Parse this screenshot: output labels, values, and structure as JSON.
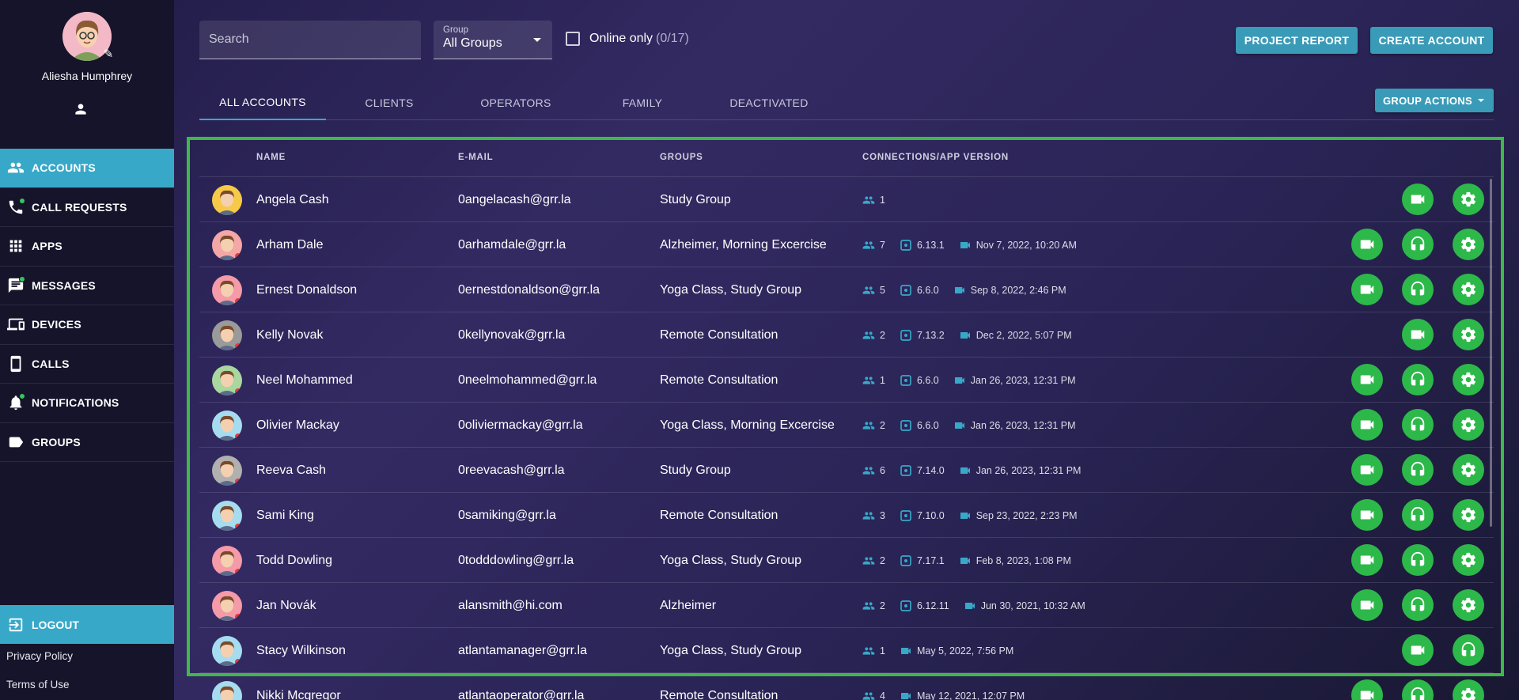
{
  "profile": {
    "name": "Aliesha Humphrey"
  },
  "nav": [
    {
      "label": "ACCOUNTS",
      "icon": "people-icon",
      "active": true,
      "dot": false
    },
    {
      "label": "CALL REQUESTS",
      "icon": "phone-icon",
      "active": false,
      "dot": true
    },
    {
      "label": "APPS",
      "icon": "apps-grid-icon",
      "active": false,
      "dot": false
    },
    {
      "label": "MESSAGES",
      "icon": "message-icon",
      "active": false,
      "dot": true
    },
    {
      "label": "DEVICES",
      "icon": "devices-icon",
      "active": false,
      "dot": false
    },
    {
      "label": "CALLS",
      "icon": "smartphone-icon",
      "active": false,
      "dot": false
    },
    {
      "label": "NOTIFICATIONS",
      "icon": "bell-icon",
      "active": false,
      "dot": true
    },
    {
      "label": "GROUPS",
      "icon": "label-icon",
      "active": false,
      "dot": false
    }
  ],
  "logout": "LOGOUT",
  "footer": {
    "privacy": "Privacy Policy",
    "terms": "Terms of Use"
  },
  "search": {
    "placeholder": "Search"
  },
  "group_filter": {
    "label": "Group",
    "value": "All Groups"
  },
  "online": {
    "label": "Online only",
    "count": "(0/17)"
  },
  "buttons": {
    "project_report": "PROJECT REPORT",
    "create_account": "CREATE ACCOUNT",
    "group_actions": "GROUP ACTIONS"
  },
  "tabs": [
    "ALL ACCOUNTS",
    "CLIENTS",
    "OPERATORS",
    "FAMILY",
    "DEACTIVATED"
  ],
  "columns": {
    "name": "NAME",
    "email": "E-MAIL",
    "groups": "GROUPS",
    "connections": "CONNECTIONS/APP VERSION"
  },
  "accounts": [
    {
      "name": "Angela Cash",
      "email": "0angelacash@grr.la",
      "groups": "Study Group",
      "connections": "1",
      "version": "",
      "last_call": "",
      "video": true,
      "audio": false,
      "settings": true,
      "avatar_color": "#f7c948",
      "status": "none"
    },
    {
      "name": "Arham Dale",
      "email": "0arhamdale@grr.la",
      "groups": "Alzheimer, Morning Excercise",
      "connections": "7",
      "version": "6.13.1",
      "last_call": "Nov 7, 2022, 10:20 AM",
      "video": true,
      "audio": true,
      "settings": true,
      "avatar_color": "#f4a7a7",
      "status": "offline"
    },
    {
      "name": "Ernest Donaldson",
      "email": "0ernestdonaldson@grr.la",
      "groups": "Yoga Class, Study Group",
      "connections": "5",
      "version": "6.6.0",
      "last_call": "Sep 8, 2022, 2:46 PM",
      "video": true,
      "audio": true,
      "settings": true,
      "avatar_color": "#f49aa8",
      "status": "offline"
    },
    {
      "name": "Kelly Novak",
      "email": "0kellynovak@grr.la",
      "groups": "Remote Consultation",
      "connections": "2",
      "version": "7.13.2",
      "last_call": "Dec 2, 2022, 5:07 PM",
      "video": true,
      "audio": false,
      "settings": true,
      "avatar_color": "#9a9a9a",
      "status": "offline"
    },
    {
      "name": "Neel Mohammed",
      "email": "0neelmohammed@grr.la",
      "groups": "Remote Consultation",
      "connections": "1",
      "version": "6.6.0",
      "last_call": "Jan 26, 2023, 12:31 PM",
      "video": true,
      "audio": true,
      "settings": true,
      "avatar_color": "#a8d8a0",
      "status": "offline"
    },
    {
      "name": "Olivier Mackay",
      "email": "0oliviermackay@grr.la",
      "groups": "Yoga Class, Morning Excercise",
      "connections": "2",
      "version": "6.6.0",
      "last_call": "Jan 26, 2023, 12:31 PM",
      "video": true,
      "audio": true,
      "settings": true,
      "avatar_color": "#a6dcef",
      "status": "offline"
    },
    {
      "name": "Reeva Cash",
      "email": "0reevacash@grr.la",
      "groups": "Study Group",
      "connections": "6",
      "version": "7.14.0",
      "last_call": "Jan 26, 2023, 12:31 PM",
      "video": true,
      "audio": true,
      "settings": true,
      "avatar_color": "#b0b0b0",
      "status": "offline"
    },
    {
      "name": "Sami King",
      "email": "0samiking@grr.la",
      "groups": "Remote Consultation",
      "connections": "3",
      "version": "7.10.0",
      "last_call": "Sep 23, 2022, 2:23 PM",
      "video": true,
      "audio": true,
      "settings": true,
      "avatar_color": "#a6dcef",
      "status": "offline"
    },
    {
      "name": "Todd Dowling",
      "email": "0todddowling@grr.la",
      "groups": "Yoga Class, Study Group",
      "connections": "2",
      "version": "7.17.1",
      "last_call": "Feb 8, 2023, 1:08 PM",
      "video": true,
      "audio": true,
      "settings": true,
      "avatar_color": "#f49aa8",
      "status": "offline"
    },
    {
      "name": "Jan Novák",
      "email": "alansmith@hi.com",
      "groups": "Alzheimer",
      "connections": "2",
      "version": "6.12.11",
      "last_call": "Jun 30, 2021, 10:32 AM",
      "video": true,
      "audio": true,
      "settings": true,
      "avatar_color": "#f49aa8",
      "status": "offline"
    },
    {
      "name": "Stacy Wilkinson",
      "email": "atlantamanager@grr.la",
      "groups": "Yoga Class, Study Group",
      "connections": "1",
      "version": "",
      "last_call": "May 5, 2022, 7:56 PM",
      "video": true,
      "audio": true,
      "settings": false,
      "avatar_color": "#a6dcef",
      "status": "offline"
    },
    {
      "name": "Nikki Mcgregor",
      "email": "atlantaoperator@grr.la",
      "groups": "Remote Consultation",
      "connections": "4",
      "version": "",
      "last_call": "May 12, 2021, 12:07 PM",
      "video": true,
      "audio": true,
      "settings": true,
      "avatar_color": "#a6dcef",
      "status": "offline"
    }
  ]
}
